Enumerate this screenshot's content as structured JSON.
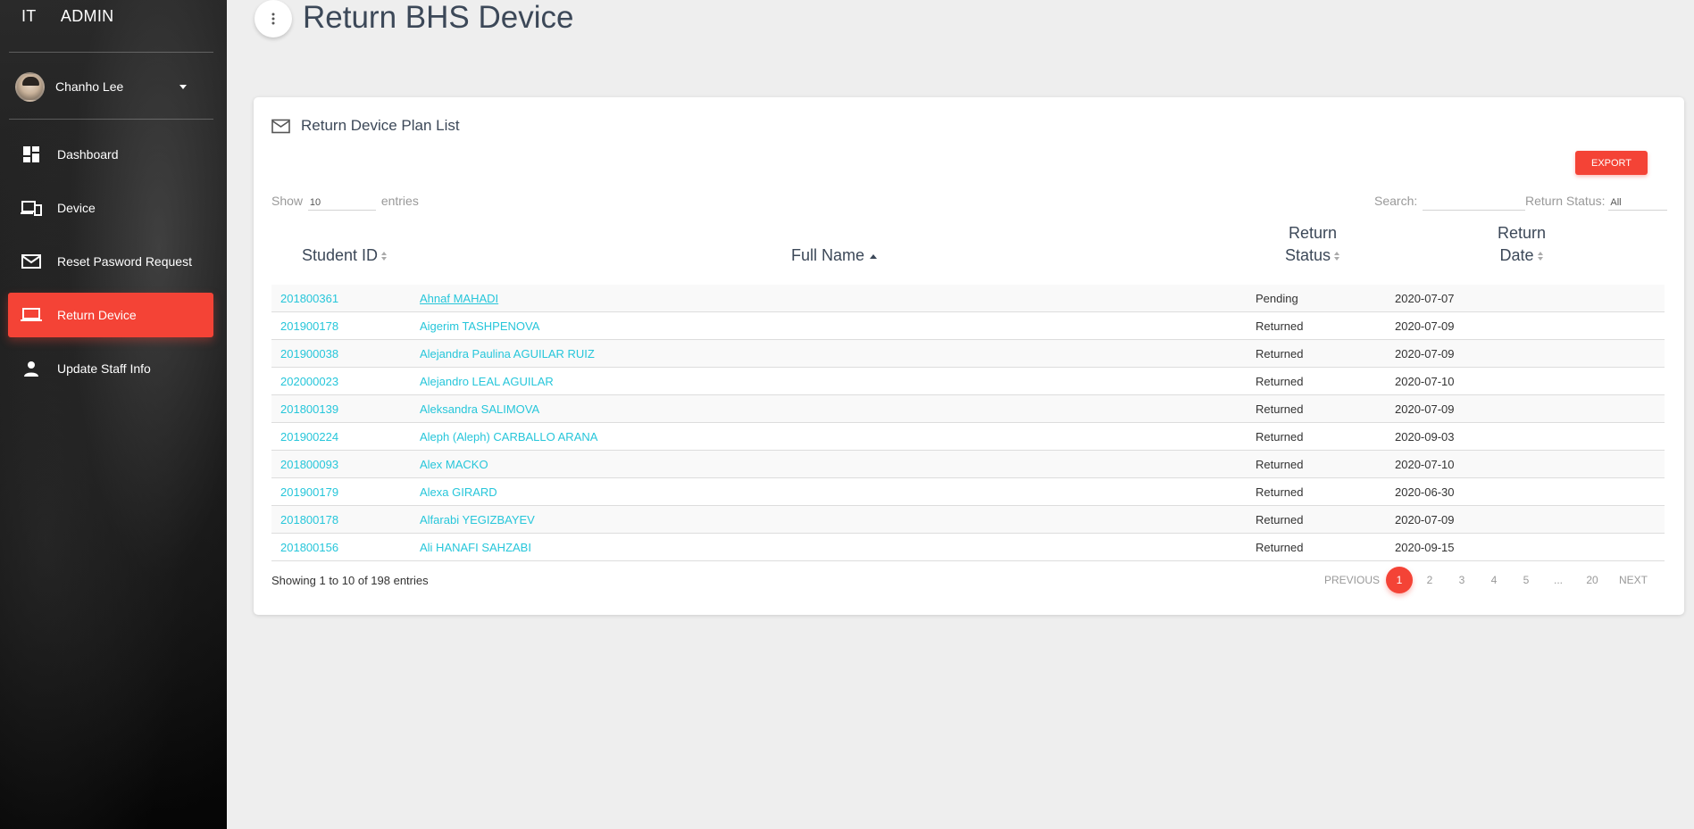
{
  "sidebar": {
    "brand_short": "IT",
    "brand_full": "ADMIN",
    "user": {
      "name": "Chanho Lee"
    },
    "items": [
      {
        "label": "Dashboard",
        "icon": "dashboard-icon"
      },
      {
        "label": "Device",
        "icon": "devices-icon"
      },
      {
        "label": "Reset Pasword Request",
        "icon": "mail-icon"
      },
      {
        "label": "Return Device",
        "icon": "laptop-icon",
        "active": true
      },
      {
        "label": "Update Staff Info",
        "icon": "person-icon"
      }
    ]
  },
  "header": {
    "title": "Return BHS Device"
  },
  "card": {
    "title": "Return Device Plan List",
    "export_label": "EXPORT",
    "show_label": "Show",
    "show_value": "10",
    "entries_label": "entries",
    "search_label": "Search:",
    "search_value": "",
    "status_label": "Return Status:",
    "status_value": "All"
  },
  "table": {
    "headers": {
      "student_id": "Student ID",
      "full_name": "Full Name",
      "status_line1": "Return",
      "status_line2": "Status",
      "date_line1": "Return",
      "date_line2": "Date"
    },
    "rows": [
      {
        "id": "201800361",
        "name": "Ahnaf MAHADI",
        "status": "Pending",
        "date": "2020-07-07"
      },
      {
        "id": "201900178",
        "name": "Aigerim TASHPENOVA",
        "status": "Returned",
        "date": "2020-07-09"
      },
      {
        "id": "201900038",
        "name": "Alejandra Paulina AGUILAR RUIZ",
        "status": "Returned",
        "date": "2020-07-09"
      },
      {
        "id": "202000023",
        "name": "Alejandro LEAL AGUILAR",
        "status": "Returned",
        "date": "2020-07-10"
      },
      {
        "id": "201800139",
        "name": "Aleksandra SALIMOVA",
        "status": "Returned",
        "date": "2020-07-09"
      },
      {
        "id": "201900224",
        "name": "Aleph (Aleph) CARBALLO ARANA",
        "status": "Returned",
        "date": "2020-09-03"
      },
      {
        "id": "201800093",
        "name": "Alex MACKO",
        "status": "Returned",
        "date": "2020-07-10"
      },
      {
        "id": "201900179",
        "name": "Alexa GIRARD",
        "status": "Returned",
        "date": "2020-06-30"
      },
      {
        "id": "201800178",
        "name": "Alfarabi YEGIZBAYEV",
        "status": "Returned",
        "date": "2020-07-09"
      },
      {
        "id": "201800156",
        "name": "Ali HANAFI SAHZABI",
        "status": "Returned",
        "date": "2020-09-15"
      }
    ]
  },
  "footer": {
    "info": "Showing 1 to 10 of 198 entries",
    "pagination": {
      "previous": "PREVIOUS",
      "pages": [
        "1",
        "2",
        "3",
        "4",
        "5",
        "...",
        "20"
      ],
      "next": "NEXT",
      "current": "1"
    }
  },
  "colors": {
    "accent": "#f44336",
    "link": "#26c6da",
    "title": "#3c4858"
  }
}
